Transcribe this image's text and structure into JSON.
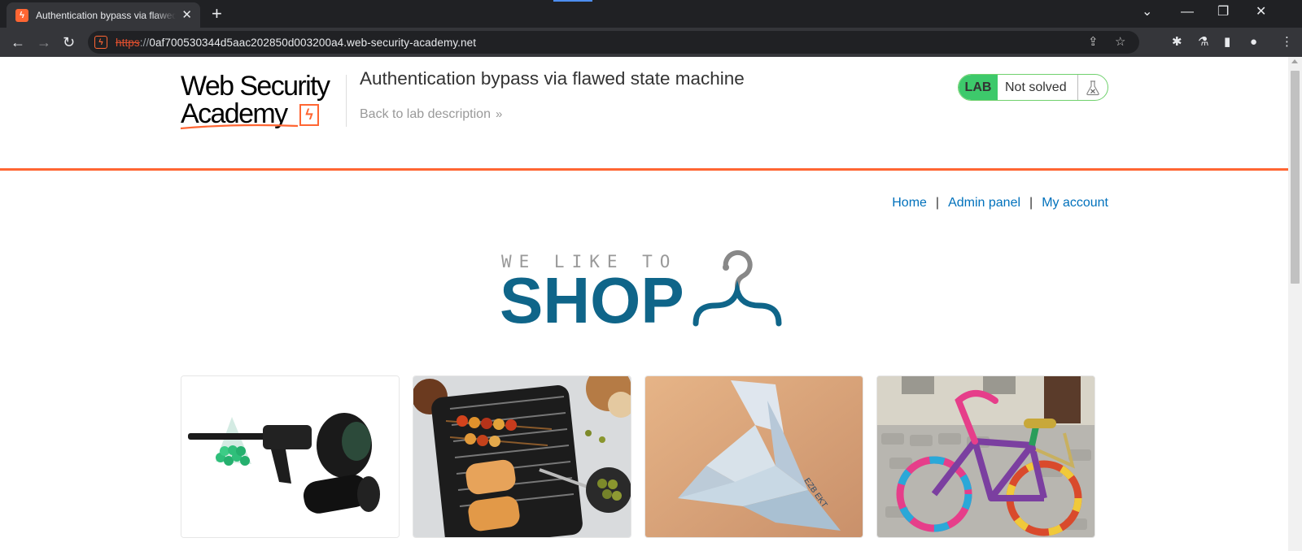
{
  "browser": {
    "tab_title": "Authentication bypass via flawed state machine",
    "tab_favicon_glyph": "ϟ",
    "new_tab_glyph": "+",
    "url_scheme": "https",
    "url_sep": "://",
    "url_host": "0af700530344d5aac202850d003200a4.web-security-academy.net",
    "icons": {
      "back": "arrow-left-icon",
      "forward": "arrow-right-icon",
      "reload": "reload-icon",
      "share": "share-icon",
      "bookmark": "star-icon",
      "extensions": "puzzle-icon",
      "labs": "flask-icon",
      "sidepanel": "side-panel-icon",
      "profile": "profile-icon",
      "menu": "kebab-menu-icon"
    },
    "colors": {
      "frame": "#202124",
      "toolbar": "#35363a",
      "insecure": "#e2502f"
    }
  },
  "header": {
    "logo_line1": "Web Security",
    "logo_line2": "Academy",
    "lab_title": "Authentication bypass via flawed state machine",
    "back_link": "Back to lab description",
    "back_chevron": "»",
    "lab_badge": "LAB",
    "lab_status": "Not solved",
    "colors": {
      "accent": "#ff6633",
      "badge": "#3dc96b",
      "link": "#0071bc"
    }
  },
  "nav": {
    "home": "Home",
    "admin": "Admin panel",
    "account": "My account",
    "separator": "|"
  },
  "shop": {
    "tagline": "WE LIKE TO",
    "word": "SHOP",
    "brand_color": "#0f6589"
  },
  "products": [
    {
      "image": "paintball-gun"
    },
    {
      "image": "grill-skewers"
    },
    {
      "image": "origami-bird"
    },
    {
      "image": "knitted-bicycle"
    }
  ]
}
